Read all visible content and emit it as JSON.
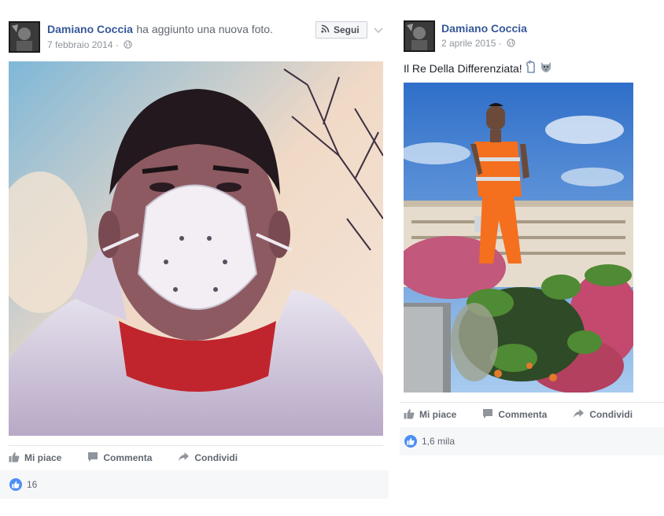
{
  "posts": [
    {
      "author": "Damiano Coccia",
      "action": "ha aggiunto una nuova foto.",
      "date": "7 febbraio 2014",
      "follow_label": "Segui",
      "actions": {
        "like": "Mi piace",
        "comment": "Commenta",
        "share": "Condividi"
      },
      "likes_count": "16"
    },
    {
      "author": "Damiano Coccia",
      "date": "2 aprile 2015",
      "caption": "Il Re Della Differenziata!",
      "actions": {
        "like": "Mi piace",
        "comment": "Commenta",
        "share": "Condividi"
      },
      "likes_count": "1,6 mila"
    }
  ],
  "icons": {
    "privacy": "globe-icon",
    "follow": "rss-icon",
    "menu": "chevron-down-icon",
    "like": "thumbs-up-icon",
    "comment": "comment-icon",
    "share": "share-arrow-icon",
    "reaction": "like-reaction-icon"
  },
  "colors": {
    "link": "#365899",
    "like_blue": "#4c8ef5",
    "muted": "#616770",
    "meta": "#90949c"
  }
}
